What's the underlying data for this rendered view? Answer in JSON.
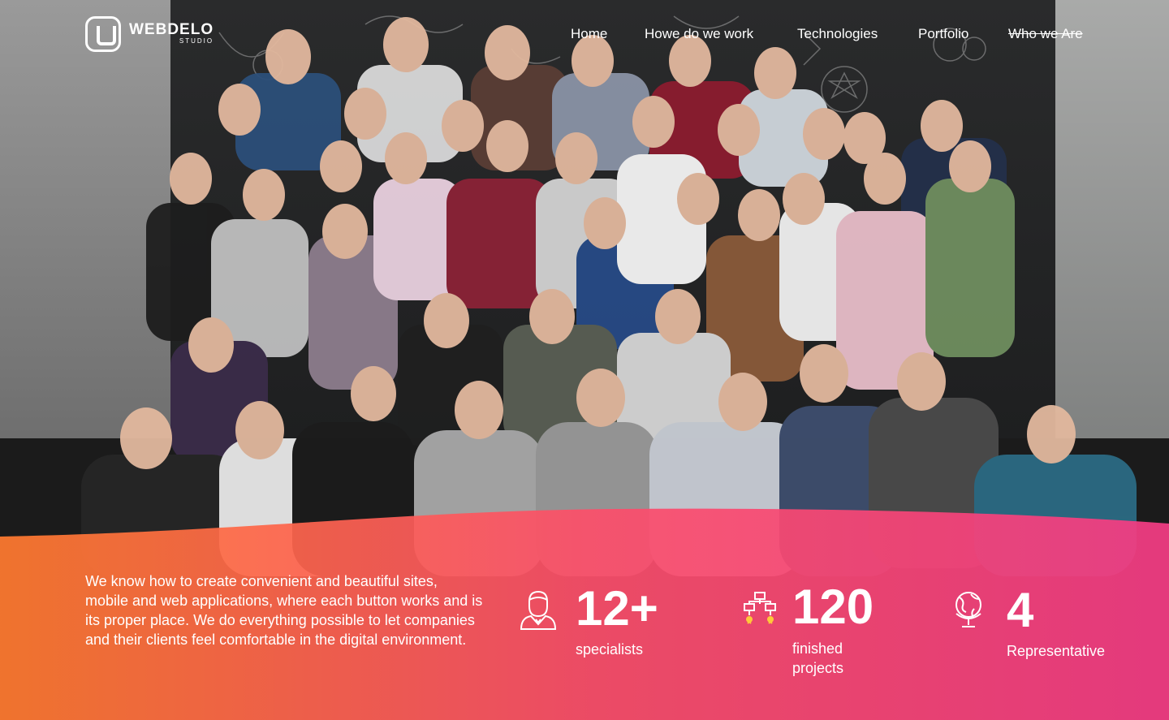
{
  "brand": {
    "name": "WEBDELO",
    "sub": "STUDIO"
  },
  "nav": {
    "items": [
      {
        "label": "Home"
      },
      {
        "label": "Howe do we work"
      },
      {
        "label": "Technologies"
      },
      {
        "label": "Portfolio"
      },
      {
        "label": "Who we Are"
      }
    ]
  },
  "intro": {
    "text": "We know how to create convenient and beautiful sites, mobile and web applications, where each button works and is its proper place. We do everything possible to let companies and their clients feel comfortable in the digital environment."
  },
  "stats": [
    {
      "value": "12+",
      "label": "specialists",
      "icon": "specialist-icon"
    },
    {
      "value": "120",
      "label_line1": "finished",
      "label_line2": "projects",
      "icon": "project-tree-icon"
    },
    {
      "value": "4",
      "label": "Representative",
      "icon": "globe-icon"
    }
  ],
  "colors": {
    "gradient_start": "#ff7a2f",
    "gradient_mid": "#fb4f6a",
    "gradient_end": "#f33c84",
    "text": "#ffffff"
  }
}
